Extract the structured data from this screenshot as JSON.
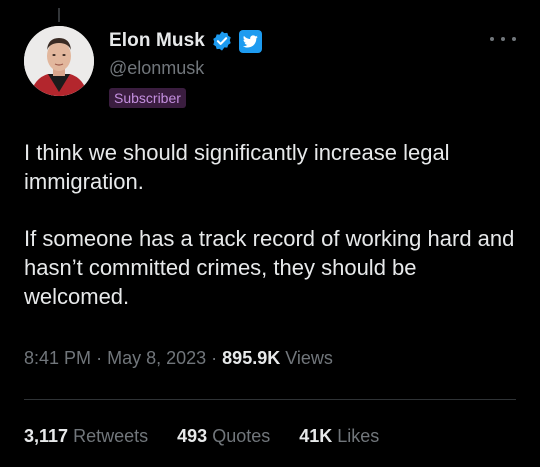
{
  "user": {
    "display_name": "Elon Musk",
    "handle": "@elonmusk",
    "subscriber_label": "Subscriber",
    "avatar_icon": "profile-photo-avatar",
    "verified_icon": "verified-check-icon",
    "affiliation_icon": "twitter-bird-badge-icon"
  },
  "tweet": {
    "paragraphs": [
      "I think we should significantly increase legal immigration.",
      "If someone has a track record of working hard and hasn’t committed crimes, they should be welcomed."
    ],
    "time": "8:41 PM",
    "sep1": "·",
    "date": "May 8, 2023",
    "sep2": "·",
    "views_count": "895.9K",
    "views_label": "Views"
  },
  "stats": {
    "retweets_count": "3,117",
    "retweets_label": "Retweets",
    "quotes_count": "493",
    "quotes_label": "Quotes",
    "likes_count": "41K",
    "likes_label": "Likes"
  },
  "colors": {
    "background": "#000000",
    "primary_text": "#e7e9ea",
    "secondary_text": "#71767b",
    "accent_blue": "#1d9bf0",
    "subscriber_bg": "#3a1d3f",
    "subscriber_text": "#c48fdf"
  }
}
